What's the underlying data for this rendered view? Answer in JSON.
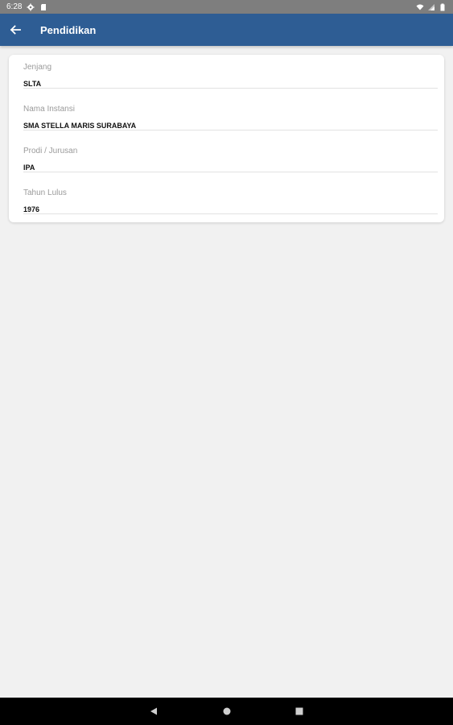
{
  "status_bar": {
    "time": "6:28",
    "icons": [
      "gear-icon",
      "sd-card-icon",
      "wifi-icon",
      "signal-icon",
      "battery-icon"
    ]
  },
  "app_bar": {
    "title": "Pendidikan",
    "back_icon": "arrow-left-icon",
    "color": "#2e5d94"
  },
  "fields": [
    {
      "label": "Jenjang",
      "value": "SLTA"
    },
    {
      "label": "Nama Instansi",
      "value": "SMA STELLA MARIS SURABAYA"
    },
    {
      "label": "Prodi / Jurusan",
      "value": "IPA"
    },
    {
      "label": "Tahun Lulus",
      "value": "1976"
    }
  ],
  "nav_bar": {
    "icons": [
      "back-triangle-icon",
      "home-circle-icon",
      "recents-square-icon"
    ]
  }
}
